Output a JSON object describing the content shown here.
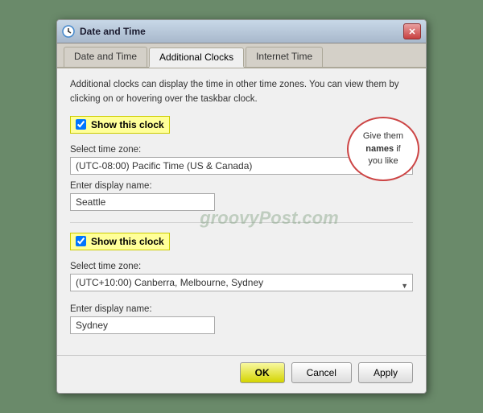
{
  "dialog": {
    "title": "Date and Time",
    "close_label": "✕"
  },
  "tabs": [
    {
      "id": "date-time",
      "label": "Date and Time",
      "active": false
    },
    {
      "id": "additional-clocks",
      "label": "Additional Clocks",
      "active": true
    },
    {
      "id": "internet-time",
      "label": "Internet Time",
      "active": false
    }
  ],
  "description": "Additional clocks can display the time in other time zones. You can view them by clicking on or hovering over the taskbar clock.",
  "clock1": {
    "checkbox_label": "Show this clock",
    "checked": true,
    "timezone_label": "Select time zone:",
    "timezone_value": "(UTC-08:00) Pacific Time (US & Canada)",
    "displayname_label": "Enter display name:",
    "displayname_value": "Seattle"
  },
  "clock2": {
    "checkbox_label": "Show this clock",
    "checked": true,
    "timezone_label": "Select time zone:",
    "timezone_value": "(UTC+10:00) Canberra, Melbourne, Sydney",
    "displayname_label": "Enter display name:",
    "displayname_value": "Sydney"
  },
  "annotation": {
    "line1": "Give them",
    "bold": "names",
    "line2": "if\nyou like"
  },
  "watermark": "groovyPost.com",
  "buttons": {
    "ok": "OK",
    "cancel": "Cancel",
    "apply": "Apply"
  }
}
